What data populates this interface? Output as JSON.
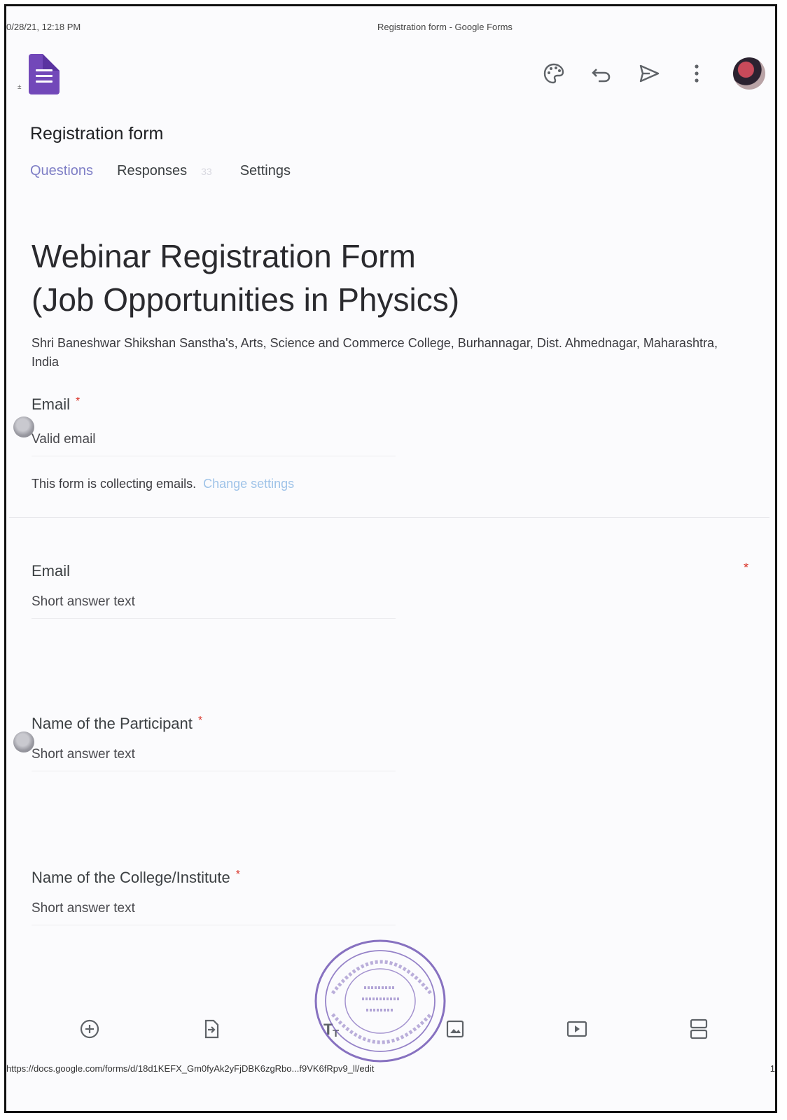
{
  "print_header": {
    "timestamp": "0/28/21, 12:18 PM",
    "page_title": "Registration form - Google Forms"
  },
  "app_bar": {
    "small_mark": "±",
    "icons": [
      "palette-icon",
      "undo-icon",
      "send-icon",
      "more-vert-icon"
    ]
  },
  "form_name": "Registration form",
  "tabs": {
    "questions": "Questions",
    "responses": "Responses",
    "responses_count": "33",
    "settings": "Settings"
  },
  "form": {
    "title_line1": "Webinar Registration Form",
    "title_line2": "(Job Opportunities in Physics)",
    "description": "Shri Baneshwar Shikshan Sanstha's, Arts, Science and Commerce College, Burhannagar, Dist. Ahmednagar, Maharashtra, India"
  },
  "email_collection": {
    "label": "Email",
    "required_mark": "*",
    "placeholder": "Valid email",
    "note": "This form is collecting emails.",
    "change_link": "Change settings"
  },
  "questions": [
    {
      "label": "Email",
      "required_mark": "*",
      "answer": "Short answer text"
    },
    {
      "label": "Name of the Participant",
      "required_mark": "*",
      "answer": "Short answer text"
    },
    {
      "label": "Name of the College/Institute",
      "required_mark": "*",
      "answer": "Short answer text"
    }
  ],
  "bottom_toolbar": [
    "add-question-icon",
    "import-questions-icon",
    "add-title-icon",
    "add-image-icon",
    "add-video-icon",
    "add-section-icon"
  ],
  "footer": {
    "url": "https://docs.google.com/forms/d/18d1KEFX_Gm0fyAk2yFjDBK6zgRbo...f9VK6fRpv9_ll/edit",
    "page": "1"
  },
  "colors": {
    "forms_purple": "#7248b9",
    "tab_active": "#7f7fc6",
    "required_red": "#d93025",
    "link_blue": "#9fc3e8",
    "seal_purple": "#6a4fb0"
  }
}
